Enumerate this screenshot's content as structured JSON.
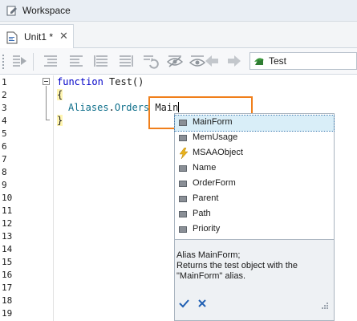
{
  "window": {
    "title": "Workspace"
  },
  "tabs": [
    {
      "label": "Unit1 *",
      "close_glyph": "✕"
    }
  ],
  "toolbar": {
    "routine_selector": {
      "value": "Test",
      "icon": "routine-icon"
    },
    "icons": [
      "run-icon",
      "indent-left-icon",
      "indent-right-icon",
      "comment-icon",
      "uncomment-icon",
      "refresh-icon",
      "hide-icon",
      "show-icon",
      "back-arrow-icon",
      "forward-arrow-icon"
    ]
  },
  "editor": {
    "line_numbers": [
      "1",
      "2",
      "3",
      "4",
      "5",
      "6",
      "7",
      "8",
      "9",
      "10",
      "11",
      "12",
      "13",
      "14",
      "15",
      "16",
      "17",
      "18",
      "19"
    ],
    "lines": {
      "l1": {
        "keyword": "function",
        "rest": " Test()"
      },
      "l2": {
        "brace": "{"
      },
      "l3": {
        "object": "Aliases",
        "dot": ".",
        "member": "Orders",
        "space": " ",
        "typed": "Main"
      },
      "l4": {
        "brace": "}"
      }
    }
  },
  "autocomplete": {
    "items": [
      {
        "label": "MainForm",
        "icon": "property-icon",
        "selected": true
      },
      {
        "label": "MemUsage",
        "icon": "property-icon",
        "selected": false
      },
      {
        "label": "MSAAObject",
        "icon": "method-icon",
        "selected": false
      },
      {
        "label": "Name",
        "icon": "property-icon",
        "selected": false
      },
      {
        "label": "OrderForm",
        "icon": "property-icon",
        "selected": false
      },
      {
        "label": "Parent",
        "icon": "property-icon",
        "selected": false
      },
      {
        "label": "Path",
        "icon": "property-icon",
        "selected": false
      },
      {
        "label": "Priority",
        "icon": "property-icon",
        "selected": false
      }
    ],
    "help": {
      "line1": "Alias MainForm;",
      "line2": "Returns the test object with the",
      "line3": "\"MainForm\" alias."
    },
    "accent": "#f07f1b"
  }
}
